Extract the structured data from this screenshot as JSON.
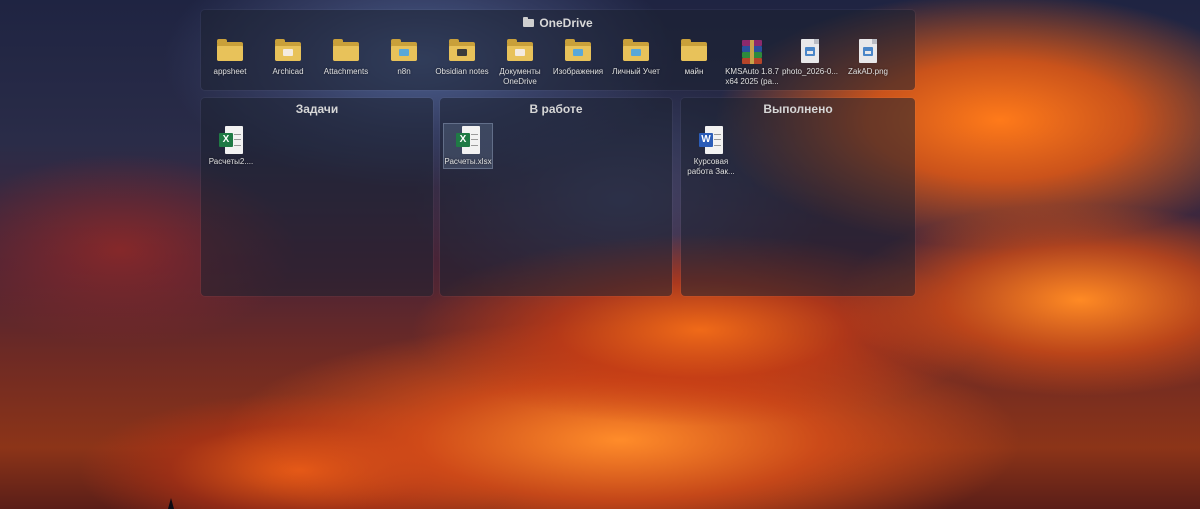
{
  "top_panel": {
    "title": "OneDrive",
    "items": [
      {
        "label": "appsheet",
        "icon": "folder-icon",
        "badge": ""
      },
      {
        "label": "Archicad",
        "icon": "folder-icon",
        "badge": "light"
      },
      {
        "label": "Attachments",
        "icon": "folder-icon",
        "badge": ""
      },
      {
        "label": "n8n",
        "icon": "folder-icon",
        "badge": "blue"
      },
      {
        "label": "Obsidian notes",
        "icon": "folder-icon",
        "badge": "dark"
      },
      {
        "label": "Документы OneDrive",
        "icon": "folder-icon",
        "badge": "light"
      },
      {
        "label": "Изображения",
        "icon": "folder-icon",
        "badge": "blue"
      },
      {
        "label": "Личный Учет",
        "icon": "folder-icon",
        "badge": "blue"
      },
      {
        "label": "майн",
        "icon": "folder-icon",
        "badge": ""
      },
      {
        "label": "KMSAuto 1.8.7 x64 2025 (ра...",
        "icon": "archive-icon",
        "badge": ""
      },
      {
        "label": "photo_2026-0...",
        "icon": "image-file-icon",
        "badge": ""
      },
      {
        "label": "ZakAD.png",
        "icon": "image-file-icon",
        "badge": ""
      }
    ]
  },
  "columns": [
    {
      "title": "Задачи",
      "files": [
        {
          "label": "Расчеты2....",
          "type": "excel-icon",
          "selected": false
        }
      ]
    },
    {
      "title": "В работе",
      "files": [
        {
          "label": "Расчеты.xlsx",
          "type": "excel-icon",
          "selected": true
        }
      ]
    },
    {
      "title": "Выполнено",
      "files": [
        {
          "label": "Курсовая работа Зак...",
          "type": "word-icon",
          "selected": false
        }
      ]
    }
  ],
  "icon_letters": {
    "excel": "X",
    "word": "W"
  },
  "colors": {
    "excel": "#1f7a45",
    "word": "#2b5db8",
    "folder": "#e8c25a"
  }
}
